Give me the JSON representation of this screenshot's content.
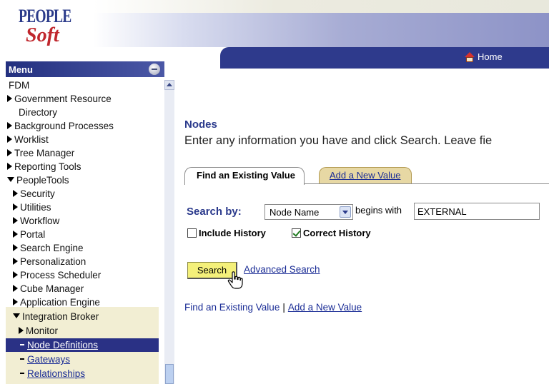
{
  "header": {
    "logo_top": "PEOPLE",
    "logo_bottom": "Soft",
    "home_label": "Home"
  },
  "menu": {
    "title": "Menu",
    "items": [
      {
        "label": "FDM",
        "kind": "text"
      },
      {
        "label": "Government Resource",
        "kind": "closed"
      },
      {
        "label": "Directory",
        "kind": "text"
      },
      {
        "label": "Background Processes",
        "kind": "closed"
      },
      {
        "label": "Worklist",
        "kind": "closed"
      },
      {
        "label": "Tree Manager",
        "kind": "closed"
      },
      {
        "label": "Reporting Tools",
        "kind": "closed"
      },
      {
        "label": "PeopleTools",
        "kind": "open"
      },
      {
        "label": "Security",
        "kind": "closed"
      },
      {
        "label": "Utilities",
        "kind": "closed"
      },
      {
        "label": "Workflow",
        "kind": "closed"
      },
      {
        "label": "Portal",
        "kind": "closed"
      },
      {
        "label": "Search Engine",
        "kind": "closed"
      },
      {
        "label": "Personalization",
        "kind": "closed"
      },
      {
        "label": "Process Scheduler",
        "kind": "closed"
      },
      {
        "label": "Cube Manager",
        "kind": "closed"
      },
      {
        "label": "Application Engine",
        "kind": "closed"
      },
      {
        "label": "Integration Broker",
        "kind": "open"
      },
      {
        "label": "Monitor",
        "kind": "closed"
      },
      {
        "label": "Node Definitions",
        "kind": "selected"
      },
      {
        "label": "Gateways",
        "kind": "link"
      },
      {
        "label": "Relationships",
        "kind": "link"
      }
    ]
  },
  "main": {
    "title": "Nodes",
    "instructions": "Enter any information you have and click Search. Leave fie",
    "tabs": [
      {
        "label": "Find an Existing Value",
        "active": true
      },
      {
        "label": "Add a New Value",
        "active": false
      }
    ],
    "search_by_label": "Search by:",
    "search_field": "Node Name",
    "operator": "begins with",
    "search_value": "EXTERNAL",
    "include_history_label": "Include History",
    "include_history_checked": false,
    "correct_history_label": "Correct History",
    "correct_history_checked": true,
    "search_button": "Search",
    "advanced_search": "Advanced Search",
    "bottom_links": [
      "Find an Existing Value",
      "Add a New Value"
    ]
  },
  "colors": {
    "nav_bar": "#2e3a8c",
    "menu_selected": "#2a3185",
    "search_button": "#f4f07a",
    "tab_inactive": "#e7d8a4"
  }
}
